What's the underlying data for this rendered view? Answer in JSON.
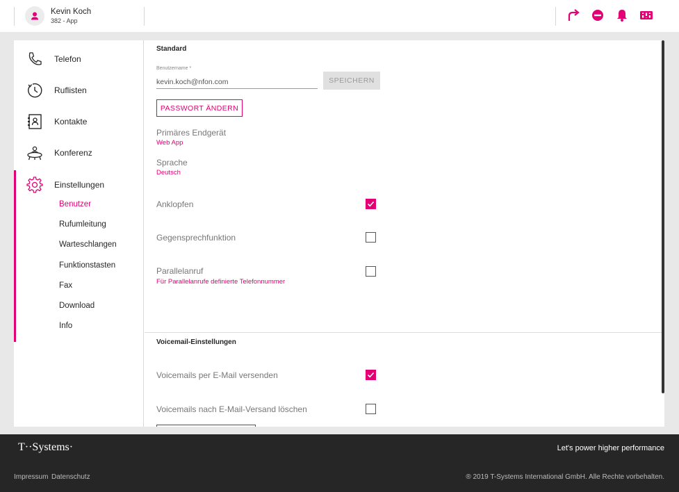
{
  "header": {
    "user_name": "Kevin Koch",
    "user_sub": "382 - App"
  },
  "sidebar": {
    "items": [
      {
        "label": "Telefon",
        "icon": "phone-icon"
      },
      {
        "label": "Ruflisten",
        "icon": "clock-icon"
      },
      {
        "label": "Kontakte",
        "icon": "contacts-icon"
      },
      {
        "label": "Konferenz",
        "icon": "conference-icon"
      },
      {
        "label": "Einstellungen",
        "icon": "gear-icon"
      }
    ],
    "sub_items": [
      "Benutzer",
      "Rufumleitung",
      "Warteschlangen",
      "Funktionstasten",
      "Fax",
      "Download",
      "Info"
    ]
  },
  "standard": {
    "title": "Standard",
    "username_label": "Benutzername *",
    "username_value": "kevin.koch@nfon.com",
    "save_label": "SPEICHERN",
    "change_password_label": "PASSWORT ÄNDERN",
    "primary_device_label": "Primäres Endgerät",
    "primary_device_value": "Web App",
    "language_label": "Sprache",
    "language_value": "Deutsch",
    "call_waiting_label": "Anklopfen",
    "call_waiting_checked": true,
    "intercom_label": "Gegensprechfunktion",
    "intercom_checked": false,
    "parallel_label": "Parallelanruf",
    "parallel_sub": "Für Parallelanrufe definierte Telefonnummer",
    "parallel_checked": false
  },
  "voicemail": {
    "title": "Voicemail-Einstellungen",
    "send_email_label": "Voicemails per E-Mail versenden",
    "send_email_checked": true,
    "delete_label": "Voicemails nach E-Mail-Versand löschen",
    "delete_checked": false
  },
  "footer": {
    "logo": "T··Systems·",
    "tagline": "Let's power higher performance",
    "impressum": "Impressum",
    "datenschutz": "Datenschutz",
    "copyright": "® 2019 T-Systems International GmbH. Alle Rechte vorbehalten."
  },
  "colors": {
    "accent": "#e20074",
    "footer_bg": "#262626"
  }
}
